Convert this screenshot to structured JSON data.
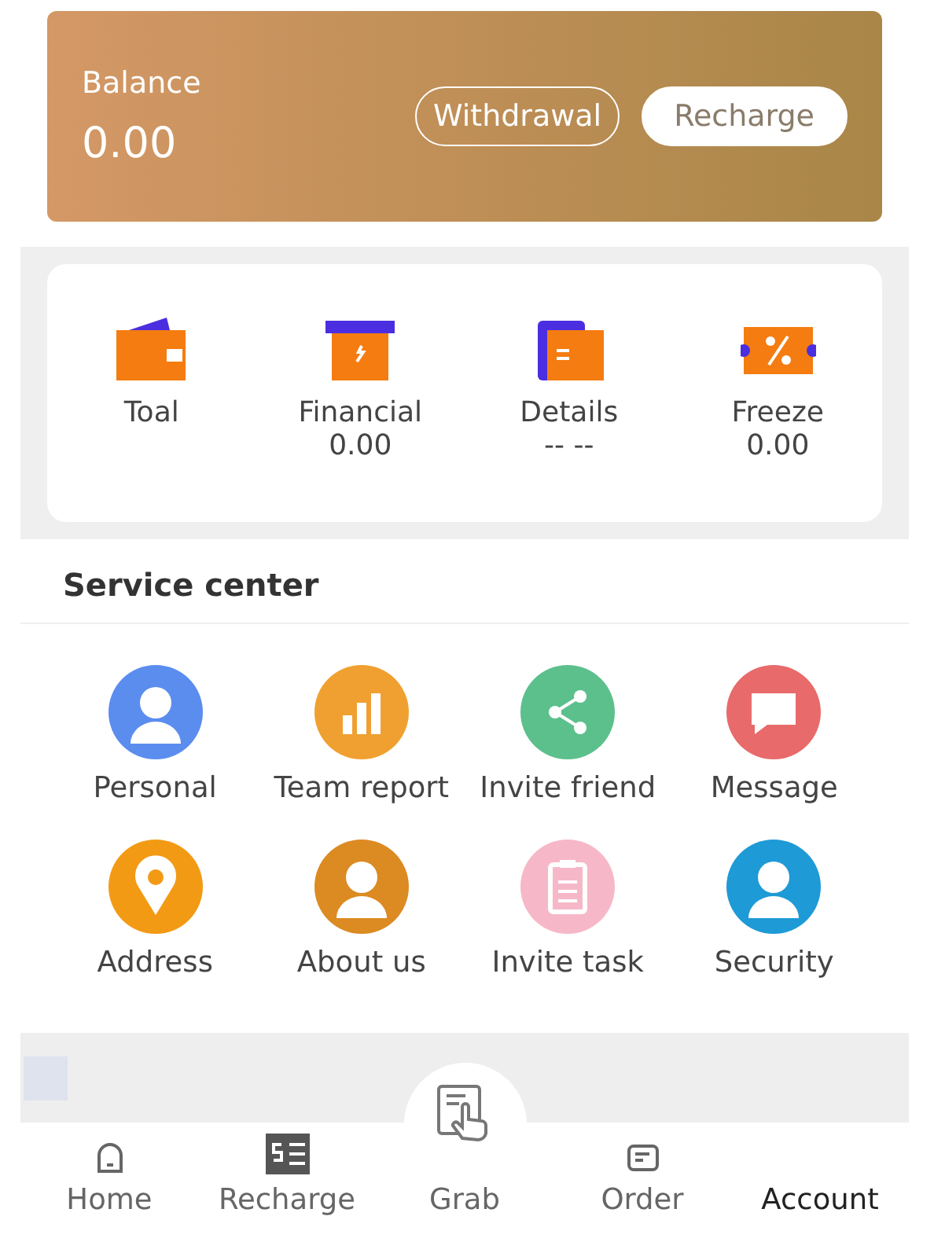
{
  "balance": {
    "label": "Balance",
    "amount": "0.00",
    "buttons": [
      {
        "label": "Withdrawal",
        "kind": "outline"
      },
      {
        "label": "Recharge",
        "kind": "solid"
      }
    ]
  },
  "stats": [
    {
      "kind": "wallet",
      "label": "Toal"
    },
    {
      "kind": "box",
      "label": "Financial",
      "value": "0.00"
    },
    {
      "kind": "folder",
      "label": "Details",
      "value": "-- --"
    },
    {
      "kind": "ticket",
      "label": "Freeze",
      "value": "0.00"
    }
  ],
  "service_center": {
    "title": "Service center",
    "items": [
      {
        "kind": "person",
        "label": "Personal",
        "color": "#5b8def"
      },
      {
        "kind": "chart",
        "label": "Team report",
        "color": "#f0a030"
      },
      {
        "kind": "share",
        "label": "Invite friend",
        "color": "#5cc08c"
      },
      {
        "kind": "chat",
        "label": "Message",
        "color": "#e86a6a"
      },
      {
        "kind": "pin",
        "label": "Address",
        "color": "#f39a14"
      },
      {
        "kind": "person",
        "label": "About us",
        "color": "#dc8a22"
      },
      {
        "kind": "clipboard",
        "label": "Invite task",
        "color": "#f6b8c8"
      },
      {
        "kind": "person",
        "label": "Security",
        "color": "#1e9ad6"
      }
    ]
  },
  "bottom_nav": [
    {
      "kind": "home",
      "label": "Home",
      "selected": false
    },
    {
      "kind": "bill",
      "label": "Recharge",
      "selected": false
    },
    {
      "kind": "grab",
      "label": "Grab",
      "selected": false
    },
    {
      "kind": "order",
      "label": "Order",
      "selected": false
    },
    {
      "kind": "none",
      "label": "Account",
      "selected": true
    }
  ]
}
